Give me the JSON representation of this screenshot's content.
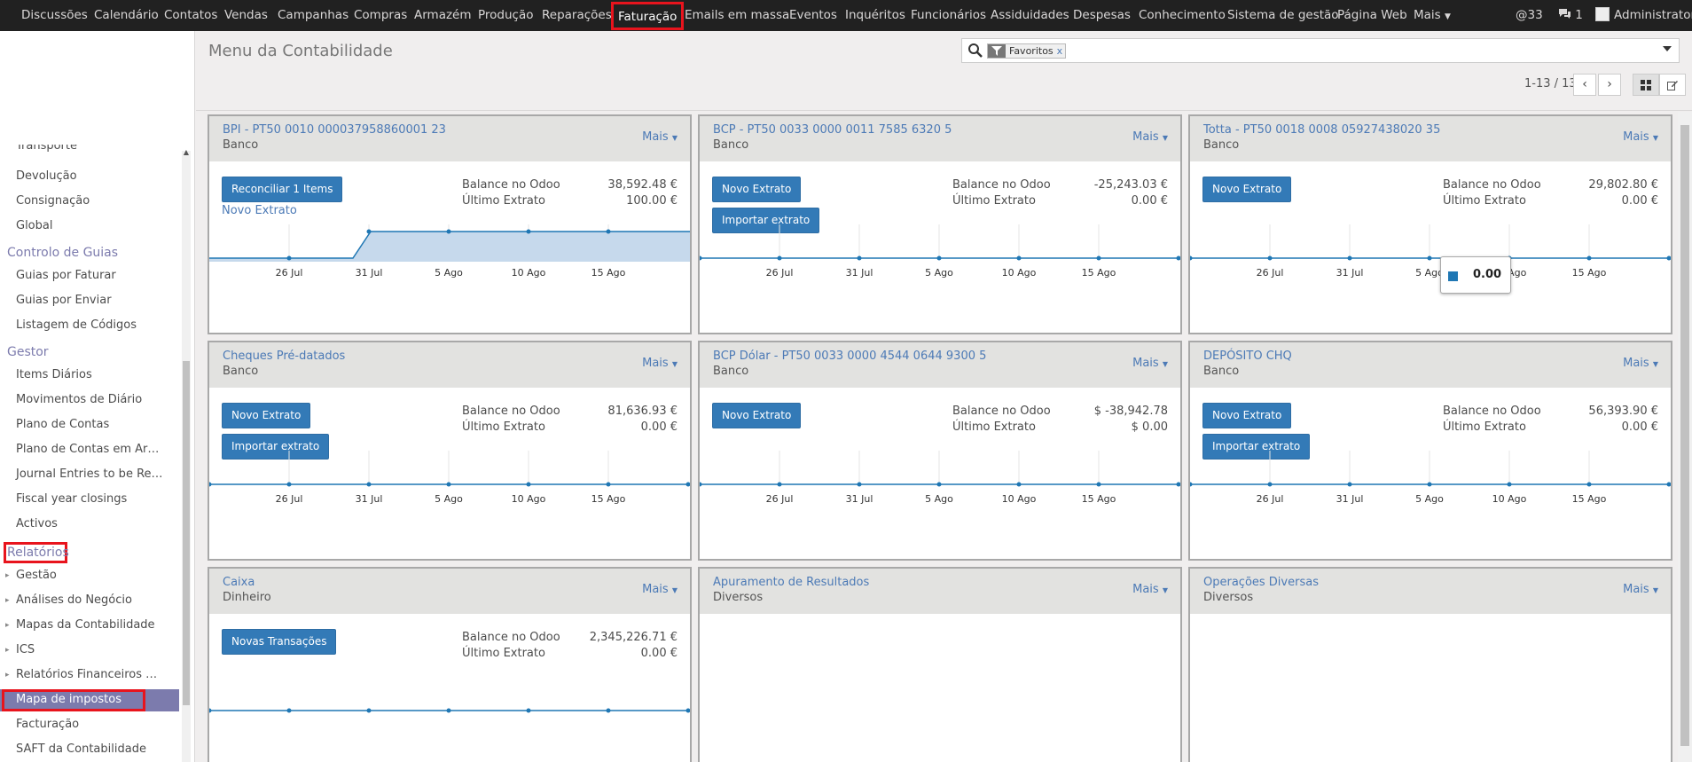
{
  "topbar": {
    "menu": [
      "Discussões",
      "Calendário",
      "Contatos",
      "Vendas",
      "Campanhas",
      "Compras",
      "Armazém",
      "Produção",
      "Reparações",
      "Faturação",
      "Emails em massa",
      "Eventos",
      "Inquéritos",
      "Funcionários",
      "Assiduidades",
      "Despesas",
      "Conhecimento",
      "Sistema de gestão",
      "Página Web",
      "Mais"
    ],
    "active": "Faturação",
    "mentions_count": "33",
    "messages_count": "1",
    "user": "Administrator"
  },
  "sidebar": {
    "items": [
      "Transporte",
      "Devolução",
      "Consignação",
      "Global"
    ],
    "controlo_head": "Controlo de Guias",
    "controlo_items": [
      "Guias por Faturar",
      "Guias por Enviar",
      "Listagem de Códigos"
    ],
    "gestor_head": "Gestor",
    "gestor_items": [
      "Items Diários",
      "Movimentos de Diário",
      "Plano de Contas",
      "Plano de Contas em Ar…",
      "Journal Entries to be Re…",
      "Fiscal year closings",
      "Activos"
    ],
    "relatorios_head": "Relatórios",
    "relatorios_groups": [
      "Gestão",
      "Análises do Negócio",
      "Mapas da Contabilidade",
      "ICS",
      "Relatórios Financeiros …"
    ],
    "selected_item": "Mapa de impostos",
    "tail_items": [
      "Facturação",
      "SAFT da Contabilidade"
    ]
  },
  "control_panel": {
    "title": "Menu da Contabilidade",
    "filter_label": "Favoritos",
    "filter_remove": "x",
    "pager": "1-13 / 13"
  },
  "dashboard": {
    "more_label": "Mais",
    "balance_label": "Balance no Odoo",
    "last_statement_label": "Último Extrato",
    "journals": [
      {
        "name": "BPI - PT50 0010 000037958860001 23",
        "type": "Banco",
        "primary_action": "Reconciliar 1 Items",
        "secondary_link": "Novo Extrato",
        "balance": "38,592.48 €",
        "last_statement": "100.00 €"
      },
      {
        "name": "BCP - PT50 0033 0000 0011 7585 6320 5",
        "type": "Banco",
        "primary_action": "Novo Extrato",
        "secondary_action": "Importar extrato",
        "balance": "-25,243.03 €",
        "last_statement": "0.00 €"
      },
      {
        "name": "Totta - PT50 0018 0008 05927438020 35",
        "type": "Banco",
        "primary_action": "Novo Extrato",
        "balance": "29,802.80 €",
        "last_statement": "0.00 €",
        "tooltip_value": "0.00"
      },
      {
        "name": "Cheques Pré-datados",
        "type": "Banco",
        "primary_action": "Novo Extrato",
        "secondary_action": "Importar extrato",
        "balance": "81,636.93 €",
        "last_statement": "0.00 €"
      },
      {
        "name": "BCP Dólar - PT50 0033 0000 4544 0644 9300 5",
        "type": "Banco",
        "primary_action": "Novo Extrato",
        "balance": "$ -38,942.78",
        "last_statement": "$ 0.00"
      },
      {
        "name": "DEPÓSITO CHQ",
        "type": "Banco",
        "primary_action": "Novo Extrato",
        "secondary_action": "Importar extrato",
        "balance": "56,393.90 €",
        "last_statement": "0.00 €"
      },
      {
        "name": "Caixa",
        "type": "Dinheiro",
        "primary_action": "Novas Transações",
        "balance": "2,345,226.71 €",
        "last_statement": "0.00 €"
      },
      {
        "name": "Apuramento de Resultados",
        "type": "Diversos"
      },
      {
        "name": "Operações Diversas",
        "type": "Diversos"
      }
    ]
  },
  "chart_data": [
    {
      "type": "area",
      "journal": "BPI - PT50 0010 000037958860001 23",
      "x_ticks": [
        "26 Jul",
        "31 Jul",
        "5 Ago",
        "10 Ago",
        "15 Ago"
      ],
      "series": [
        {
          "values": [
            0,
            0,
            1,
            1,
            1,
            1,
            1,
            1
          ]
        }
      ],
      "color": "#c6d9ec"
    },
    {
      "type": "line",
      "journal": "BCP - PT50 0033 0000 0011 7585 6320 5",
      "x_ticks": [
        "26 Jul",
        "31 Jul",
        "5 Ago",
        "10 Ago",
        "15 Ago"
      ],
      "series": [
        {
          "values": [
            0,
            0,
            0,
            0,
            0,
            0,
            0,
            0
          ]
        }
      ]
    },
    {
      "type": "line",
      "journal": "Totta - PT50 0018 0008 05927438020 35",
      "x_ticks": [
        "26 Jul",
        "31 Jul",
        "5 Ago",
        "10 Ago",
        "15 Ago"
      ],
      "series": [
        {
          "values": [
            0,
            0,
            0,
            0,
            0,
            0,
            0,
            0
          ]
        }
      ]
    },
    {
      "type": "line",
      "journal": "Cheques Pré-datados",
      "x_ticks": [
        "26 Jul",
        "31 Jul",
        "5 Ago",
        "10 Ago",
        "15 Ago"
      ],
      "series": [
        {
          "values": [
            0,
            0,
            0,
            0,
            0,
            0,
            0,
            0
          ]
        }
      ]
    },
    {
      "type": "line",
      "journal": "BCP Dólar - PT50 0033 0000 4544 0644 9300 5",
      "x_ticks": [
        "26 Jul",
        "31 Jul",
        "5 Ago",
        "10 Ago",
        "15 Ago"
      ],
      "series": [
        {
          "values": [
            0,
            0,
            0,
            0,
            0,
            0,
            0,
            0
          ]
        }
      ]
    },
    {
      "type": "line",
      "journal": "DEPÓSITO CHQ",
      "x_ticks": [
        "26 Jul",
        "31 Jul",
        "5 Ago",
        "10 Ago",
        "15 Ago"
      ],
      "series": [
        {
          "values": [
            0,
            0,
            0,
            0,
            0,
            0,
            0,
            0
          ]
        }
      ]
    },
    {
      "type": "line",
      "journal": "Caixa",
      "x_ticks": [],
      "series": [
        {
          "values": [
            0,
            0,
            0,
            0,
            0,
            0,
            0,
            0
          ]
        }
      ]
    }
  ],
  "colors": {
    "accent": "#7c7bad",
    "link": "#4c7ab6",
    "button": "#337ab7",
    "highlight": "#e8141d",
    "topbar": "#212121",
    "chart_line": "#1f77b4"
  }
}
